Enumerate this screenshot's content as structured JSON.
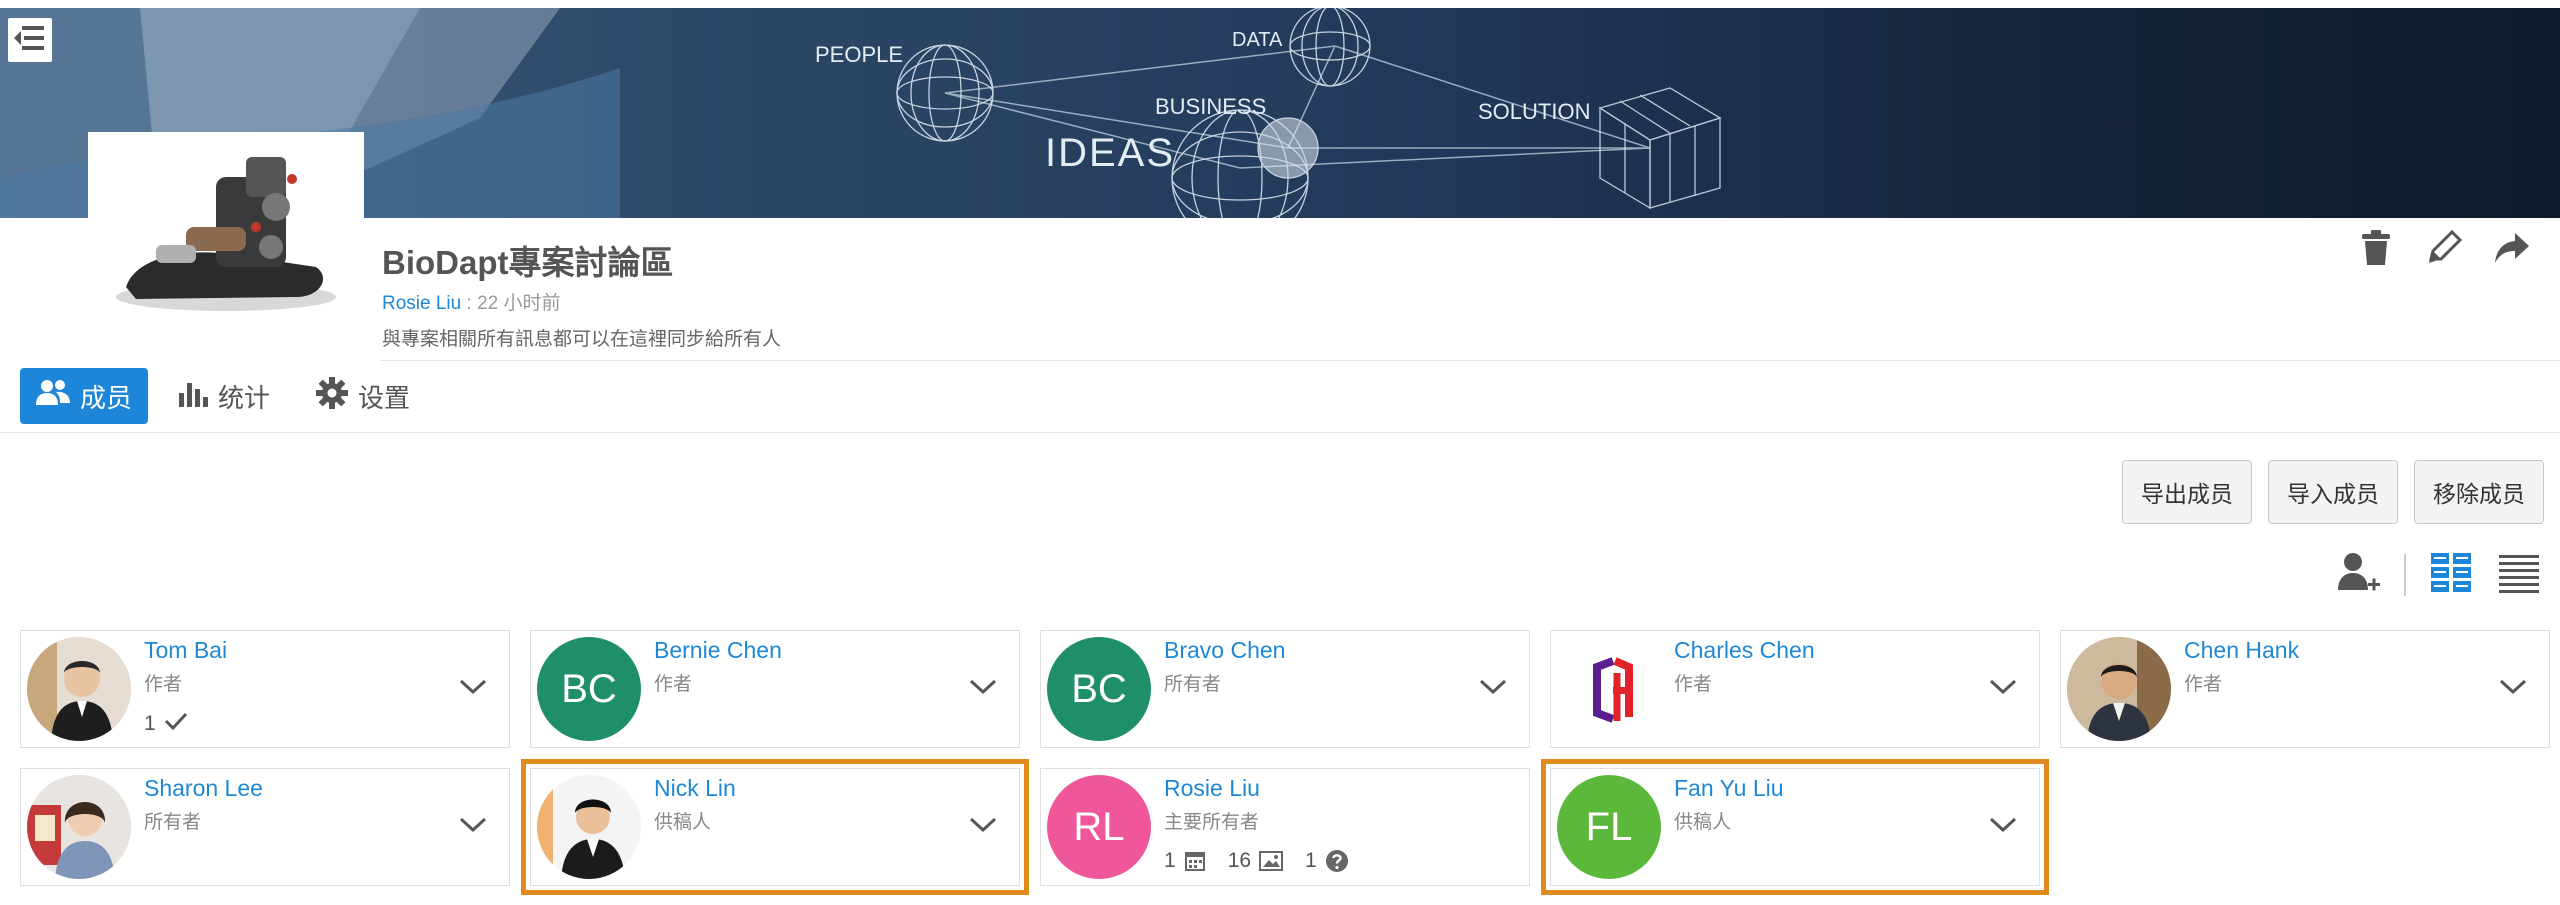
{
  "banner": {
    "words": [
      "PEOPLE",
      "DATA",
      "BUSINESS",
      "SOLUTION",
      "IDEAS"
    ]
  },
  "project": {
    "title": "BioDapt專案討論區",
    "owner": "Rosie Liu",
    "time_sep": " : ",
    "time": "22 小时前",
    "description": "與專案相關所有訊息都可以在這裡同步給所有人"
  },
  "tabs": [
    {
      "label": "成员",
      "icon": "members-icon",
      "active": true
    },
    {
      "label": "统计",
      "icon": "bar-chart-icon",
      "active": false
    },
    {
      "label": "设置",
      "icon": "gear-icon",
      "active": false
    }
  ],
  "actions": {
    "export_label": "导出成员",
    "import_label": "导入成员",
    "remove_label": "移除成员"
  },
  "members": [
    {
      "name": "Tom Bai",
      "role": "作者",
      "avatar": "photo",
      "stats": {
        "checks": "1"
      }
    },
    {
      "name": "Bernie Chen",
      "role": "作者",
      "avatar": "initials",
      "initials": "BC",
      "color": "#1f8f6a"
    },
    {
      "name": "Bravo Chen",
      "role": "所有者",
      "avatar": "initials",
      "initials": "BC",
      "color": "#1f8f6a"
    },
    {
      "name": "Charles Chen",
      "role": "作者",
      "avatar": "logo"
    },
    {
      "name": "Chen Hank",
      "role": "作者",
      "avatar": "photo"
    },
    {
      "name": "Sharon Lee",
      "role": "所有者",
      "avatar": "photo"
    },
    {
      "name": "Nick Lin",
      "role": "供稿人",
      "avatar": "photo",
      "highlight": true
    },
    {
      "name": "Rosie Liu",
      "role": "主要所有者",
      "avatar": "initials",
      "initials": "RL",
      "color": "#f0579a",
      "stats": {
        "posts": "1",
        "images": "16",
        "questions": "1"
      }
    },
    {
      "name": "Fan Yu Liu",
      "role": "供稿人",
      "avatar": "initials",
      "initials": "FL",
      "color": "#5cb83a",
      "highlight": true
    }
  ],
  "colors": {
    "accent": "#1d86d8",
    "link": "#1e88d6",
    "highlight": "#e08a1e"
  }
}
